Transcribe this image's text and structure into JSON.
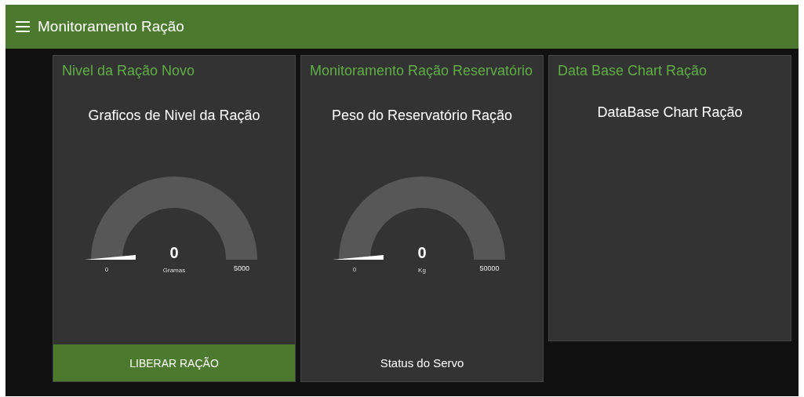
{
  "header": {
    "title": "Monitoramento Ração"
  },
  "groups": [
    {
      "title": "Nivel da Ração Novo",
      "widgets": [
        {
          "kind": "gauge",
          "label": "Graficos de Nivel da Ração",
          "value": "0",
          "units": "Gramas",
          "min": "0",
          "max": "5000"
        },
        {
          "kind": "button",
          "label": "LIBERAR RAÇÃO"
        }
      ]
    },
    {
      "title": "Monitoramento Ração Reservatório",
      "widgets": [
        {
          "kind": "gauge",
          "label": "Peso do Reservatório Ração",
          "value": "0",
          "units": "Kg",
          "min": "0",
          "max": "50000"
        },
        {
          "kind": "text",
          "label": "Status do Servo"
        }
      ]
    },
    {
      "title": "Data Base Chart Ração",
      "widgets": [
        {
          "kind": "chart",
          "label": "DataBase Chart Ração"
        }
      ]
    }
  ]
}
